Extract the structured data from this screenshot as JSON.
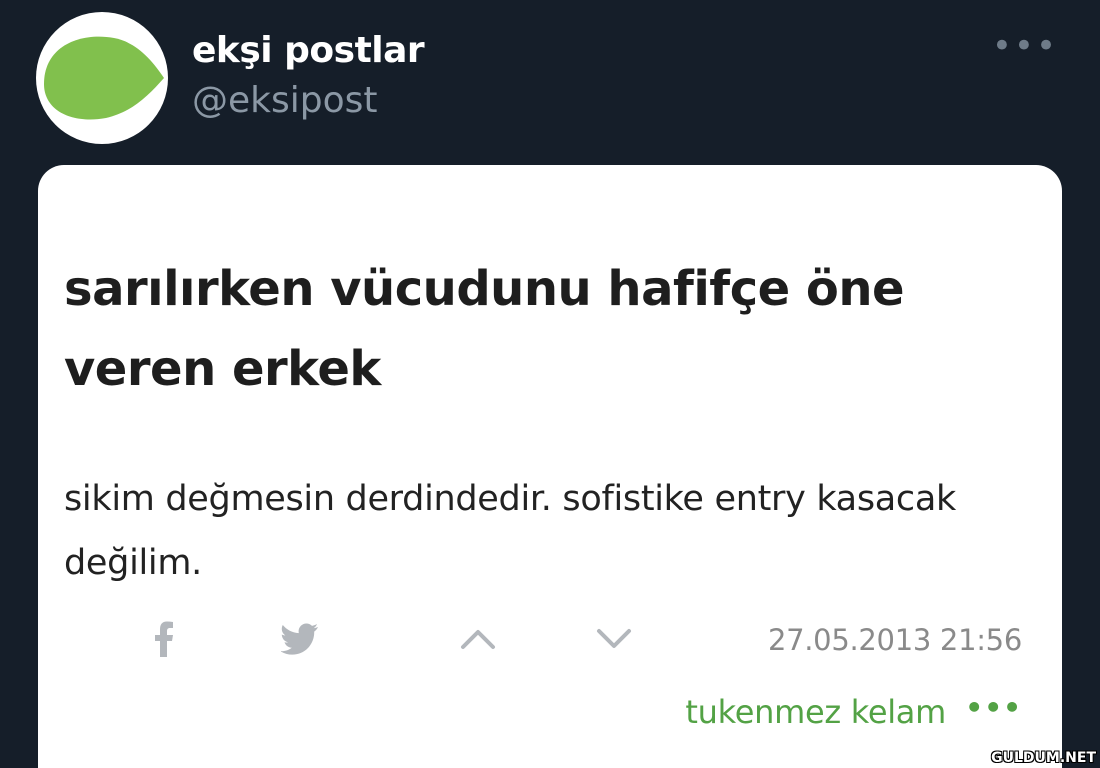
{
  "tweet": {
    "display_name": "ekşi postlar",
    "handle": "@eksipost",
    "more_icon": "more-horizontal-icon",
    "avatar_color": "#81c04d"
  },
  "entry": {
    "title": "sarılırken vücudunu hafifçe öne veren erkek",
    "body": "sikim değmesin derdindedir. sofistike entry kasacak değilim.",
    "timestamp": "27.05.2013 21:56",
    "author": "tukenmez kelam",
    "actions": [
      "facebook-icon",
      "twitter-icon",
      "upvote-icon",
      "downvote-icon"
    ],
    "accent_color": "#53a245"
  },
  "watermark": "GULDUM.NET"
}
